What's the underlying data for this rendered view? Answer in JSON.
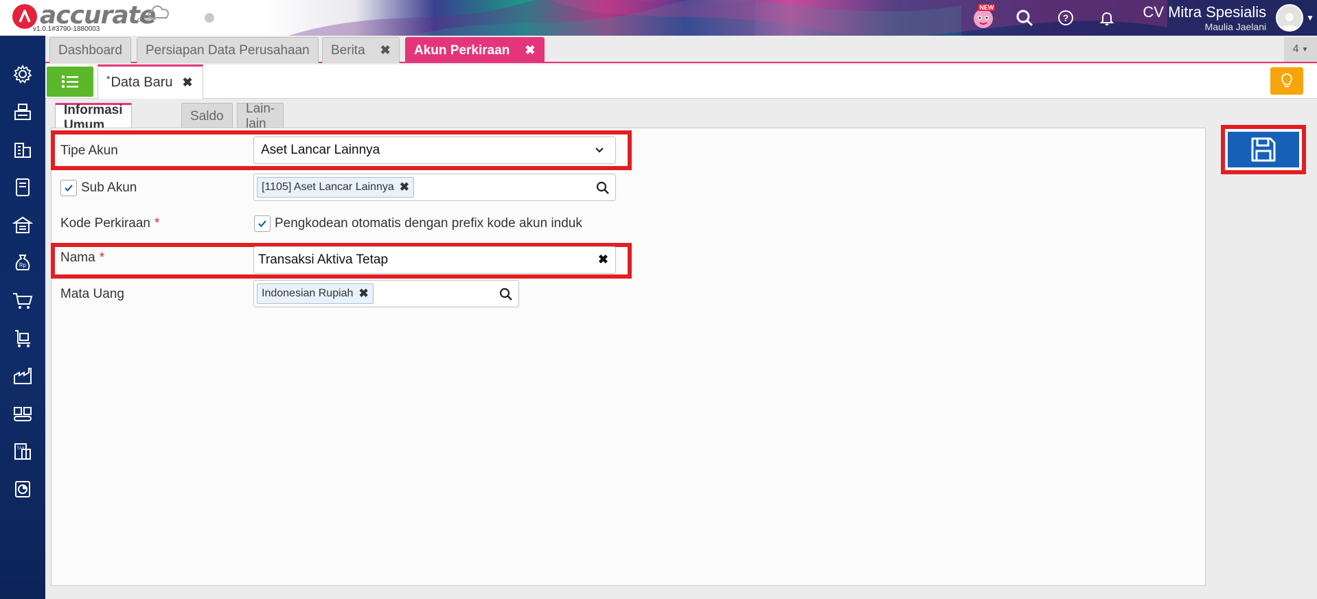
{
  "app": {
    "logo_text": "accurate",
    "logo_sub": "online",
    "version": "v1.0.1#3790-1880003",
    "new_badge": "NEW",
    "company_name": "CV Mitra Spesialis",
    "user_name": "Maulia Jaelani"
  },
  "tabs": [
    {
      "label": "Dashboard",
      "closable": false
    },
    {
      "label": "Persiapan Data Perusahaan",
      "closable": false
    },
    {
      "label": "Berita",
      "closable": true
    },
    {
      "label": "Akun Perkiraan",
      "closable": true,
      "active": true
    }
  ],
  "tab_count": "4",
  "doc_tab": {
    "marker": "*",
    "label": "Data Baru"
  },
  "form_tabs": [
    "Informasi Umum",
    "Saldo",
    "Lain-lain"
  ],
  "form": {
    "tipe_akun": {
      "label": "Tipe Akun",
      "value": "Aset Lancar Lainnya"
    },
    "sub_akun": {
      "label": "Sub Akun",
      "checked": true,
      "value": "[1105] Aset Lancar Lainnya"
    },
    "kode_perkiraan": {
      "label": "Kode Perkiraan",
      "required": "*",
      "checkbox_label": "Pengkodean otomatis dengan prefix kode akun induk",
      "checked": true
    },
    "nama": {
      "label": "Nama",
      "required": "*",
      "value": "Transaksi Aktiva Tetap"
    },
    "mata_uang": {
      "label": "Mata Uang",
      "value": "Indonesian Rupiah"
    }
  },
  "sidebar_icons": [
    "gear-icon",
    "cash-register-icon",
    "building-icon",
    "ledger-icon",
    "warehouse-icon",
    "money-bag-icon",
    "shopping-cart-icon",
    "delivery-cart-icon",
    "factory-icon",
    "conveyor-icon",
    "tax-icon",
    "report-chart-icon"
  ],
  "colors": {
    "accent_pink": "#e4357a",
    "sidebar_navy": "#0e2a66",
    "save_blue": "#1660b8",
    "list_green": "#5cb82b",
    "bulb_orange": "#f6a50b",
    "highlight_red": "#e21e23"
  }
}
